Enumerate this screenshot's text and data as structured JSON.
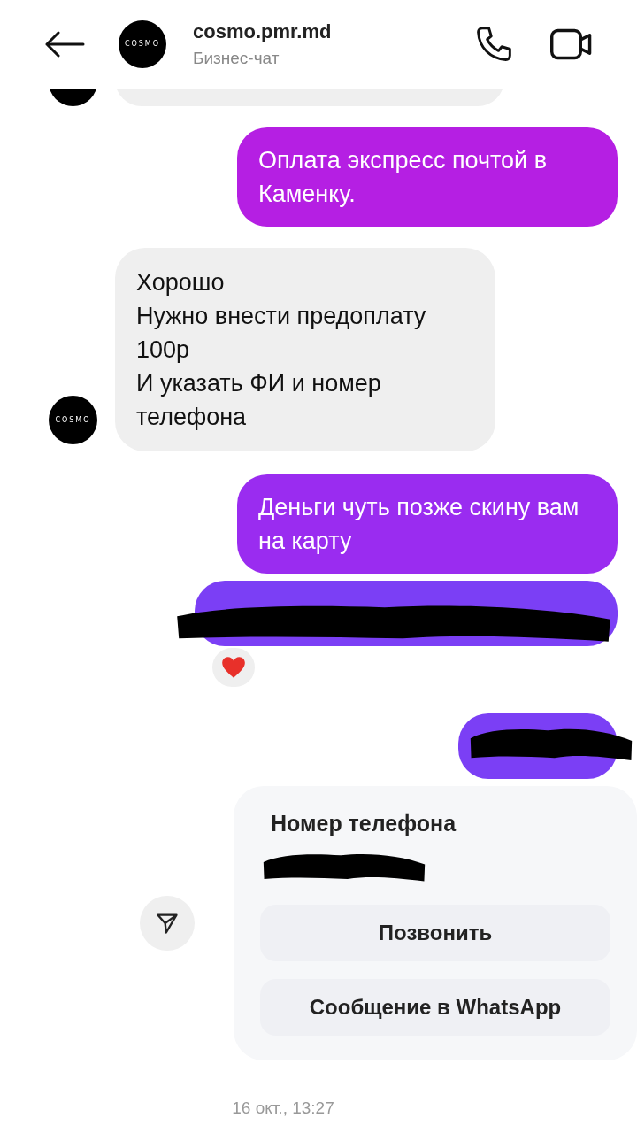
{
  "header": {
    "title": "cosmo.pmr.md",
    "subtitle": "Бизнес-чат",
    "logo": "COSMO"
  },
  "messages": [
    {
      "kind": "cut_received"
    },
    {
      "kind": "sent",
      "text": "Оплата экспресс почтой в Каменку."
    },
    {
      "kind": "received",
      "lines": [
        "Хорошо",
        "Нужно внести предоплату 100р",
        "И указать ФИ и номер телефона"
      ],
      "logo": "COSMO"
    },
    {
      "kind": "sent",
      "text": "Деньги чуть позже скину вам на карту"
    },
    {
      "kind": "redacted_long",
      "reacted": true
    },
    {
      "kind": "redacted_short"
    },
    {
      "kind": "contact",
      "title": "Номер телефона",
      "actions": [
        "Позвонить",
        "Сообщение в WhatsApp"
      ]
    }
  ],
  "timestamp": "16 окт., 13:27"
}
